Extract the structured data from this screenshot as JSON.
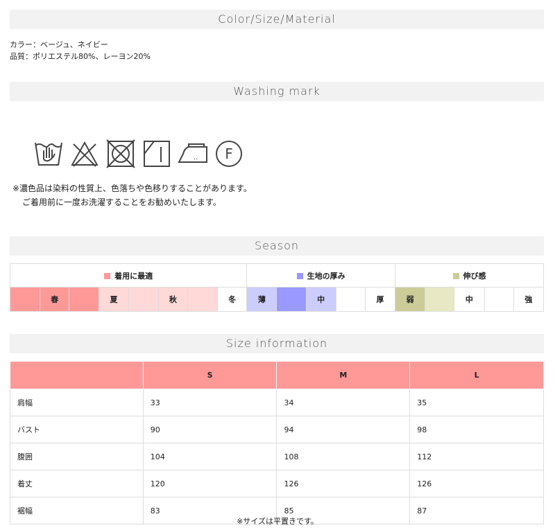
{
  "sections": {
    "material_title": "Color/Size/Material",
    "washing_title": "Washing mark",
    "season_title": "Season",
    "size_title": "Size information"
  },
  "material": {
    "color_line": "カラー：ベージュ、ネイビー",
    "quality_line": "品質：ポリエステル80%、レーヨン20%"
  },
  "washing": {
    "icons": [
      "hand-wash-icon",
      "no-bleach-icon",
      "no-tumble-dry-icon",
      "line-dry-shade-icon",
      "iron-low-icon",
      "dry-clean-f-icon"
    ],
    "iron_dots": "..",
    "dryclean_letter": "F",
    "note_line1": "※濃色品は染料の性質上、色落ちや色移りすることがあります。",
    "note_line2": "ご着用前に一度お洗濯することをお勧めいたします。"
  },
  "season": {
    "groups": [
      {
        "label": "着用に最適",
        "color": "#fe9998"
      },
      {
        "label": "生地の厚み",
        "color": "#9999ff"
      },
      {
        "label": "伸び感",
        "color": "#cccc99"
      }
    ],
    "cells": [
      "春",
      "夏",
      "秋",
      "冬",
      "薄",
      "中",
      "厚",
      "弱",
      "中",
      "強"
    ]
  },
  "size_table": {
    "headers": [
      "",
      "S",
      "M",
      "L"
    ],
    "rows": [
      [
        "肩幅",
        "33",
        "34",
        "35"
      ],
      [
        "バスト",
        "90",
        "94",
        "98"
      ],
      [
        "腹囲",
        "104",
        "108",
        "112"
      ],
      [
        "着丈",
        "120",
        "126",
        "126"
      ],
      [
        "裾幅",
        "83",
        "85",
        "87"
      ]
    ],
    "footnote": "※サイズは平置きです。"
  }
}
